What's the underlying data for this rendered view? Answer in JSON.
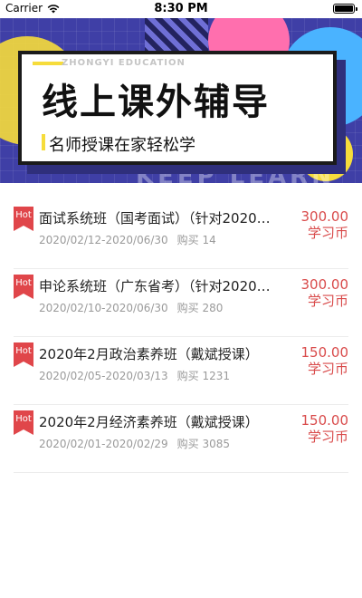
{
  "status_bar": {
    "carrier": "Carrier",
    "time": "8:30 PM"
  },
  "banner": {
    "english": "ZHONGYI EDUCATION",
    "title": "线上课外辅导",
    "subtitle": "名师授课在家轻松学",
    "watermark": "KEEP LEARN"
  },
  "courses": [
    {
      "badge": "Hot",
      "title": "面试系统班（国考面试）（针对2020…",
      "dates": "2020/02/12-2020/06/30",
      "buy": "购买 14",
      "price": "300.00",
      "unit": "学习币"
    },
    {
      "badge": "Hot",
      "title": "申论系统班（广东省考）（针对2020…",
      "dates": "2020/02/10-2020/06/30",
      "buy": "购买 280",
      "price": "300.00",
      "unit": "学习币"
    },
    {
      "badge": "Hot",
      "title": "2020年2月政治素养班（戴斌授课）",
      "dates": "2020/02/05-2020/03/13",
      "buy": "购买 1231",
      "price": "150.00",
      "unit": "学习币"
    },
    {
      "badge": "Hot",
      "title": "2020年2月经济素养班（戴斌授课）",
      "dates": "2020/02/01-2020/02/29",
      "buy": "购买 3085",
      "price": "150.00",
      "unit": "学习币"
    }
  ],
  "colors": {
    "accent": "#d94b4b",
    "hot": "#e0464a",
    "banner_bg": "#3f3fa6",
    "yellow": "#f6dc3b"
  }
}
